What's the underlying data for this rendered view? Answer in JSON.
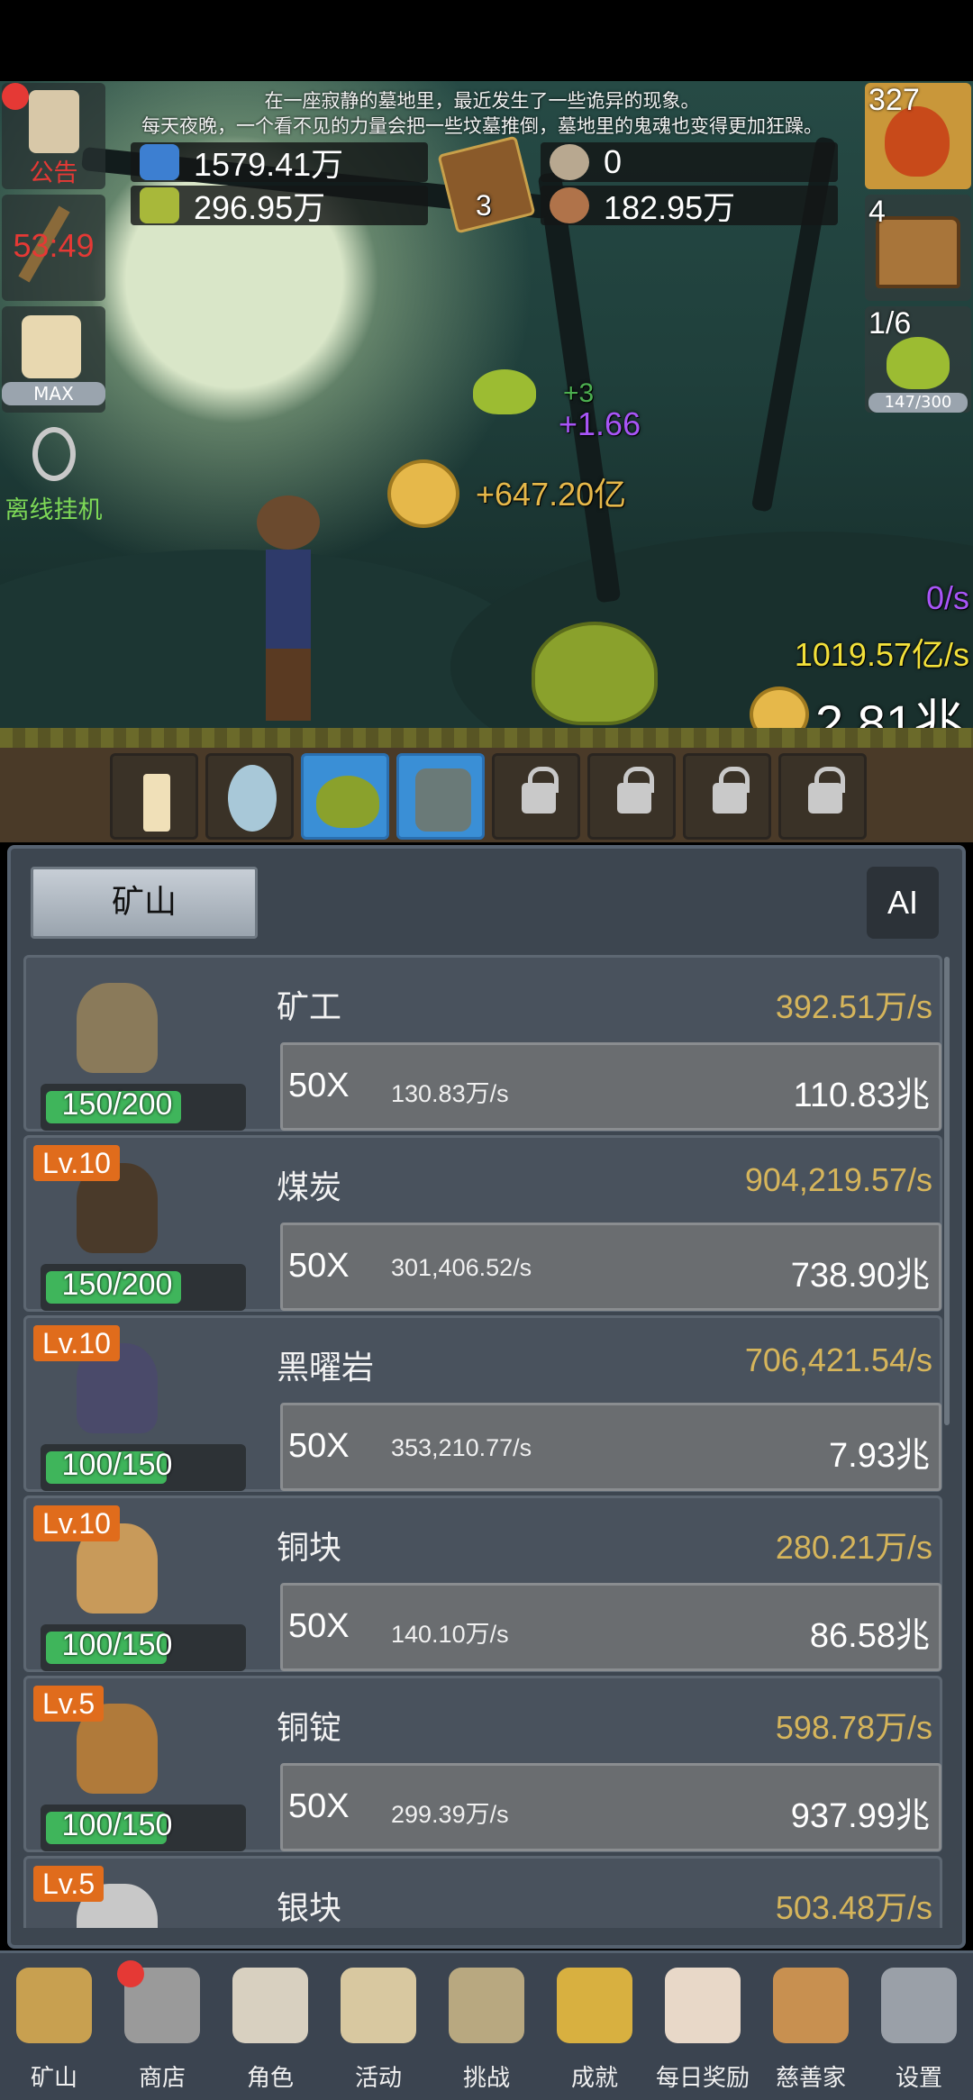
{
  "story": {
    "line1": "在一座寂静的墓地里，最近发生了一些诡异的现象。",
    "line2": "每天夜晚，一个看不见的力量会把一些坟墓推倒，墓地里的鬼魂也变得更加狂躁。"
  },
  "resources": {
    "blue_potion": "1579.41万",
    "green_potion": "296.95万",
    "book_count": "3",
    "shell": "0",
    "meat": "182.95万"
  },
  "left_buttons": {
    "notice": "公告",
    "timer": "53:49",
    "beer": "MAX",
    "offline": "离线挂机"
  },
  "right_buttons": {
    "potion_count": "327",
    "chest_count": "4",
    "slime_count": "1/6",
    "slime_hp": "147/300"
  },
  "floaters": {
    "plus_three": "+3",
    "plus_rate": "+1.66",
    "coin_gain": "+647.20亿",
    "rate_purple": "0/s",
    "rate_yellow": "1019.57亿/s",
    "total_coins": "2.81兆"
  },
  "panel": {
    "tab": "矿山",
    "ai": "AI"
  },
  "rows": [
    {
      "name": "矿工",
      "rate": "392.51万/s",
      "progress": "150/200",
      "fill": 0.75,
      "level": "",
      "mult": "50X",
      "inc": "130.83万/s",
      "cost": "110.83兆"
    },
    {
      "name": "煤炭",
      "rate": "904,219.57/s",
      "progress": "150/200",
      "fill": 0.75,
      "level": "Lv.10",
      "mult": "50X",
      "inc": "301,406.52/s",
      "cost": "738.90兆"
    },
    {
      "name": "黑曜岩",
      "rate": "706,421.54/s",
      "progress": "100/150",
      "fill": 0.67,
      "level": "Lv.10",
      "mult": "50X",
      "inc": "353,210.77/s",
      "cost": "7.93兆"
    },
    {
      "name": "铜块",
      "rate": "280.21万/s",
      "progress": "100/150",
      "fill": 0.67,
      "level": "Lv.10",
      "mult": "50X",
      "inc": "140.10万/s",
      "cost": "86.58兆"
    },
    {
      "name": "铜锭",
      "rate": "598.78万/s",
      "progress": "100/150",
      "fill": 0.67,
      "level": "Lv.5",
      "mult": "50X",
      "inc": "299.39万/s",
      "cost": "937.99兆"
    },
    {
      "name": "银块",
      "rate": "503.48万/s",
      "progress": "",
      "fill": 0,
      "level": "Lv.5",
      "mult": "",
      "inc": "",
      "cost": ""
    }
  ],
  "nav": [
    {
      "label": "矿山",
      "icon": "lantern-icon"
    },
    {
      "label": "商店",
      "icon": "stone-icon"
    },
    {
      "label": "角色",
      "icon": "skull-icon"
    },
    {
      "label": "活动",
      "icon": "scroll-icon"
    },
    {
      "label": "挑战",
      "icon": "map-icon"
    },
    {
      "label": "成就",
      "icon": "key-icon"
    },
    {
      "label": "每日奖励",
      "icon": "envelope-icon"
    },
    {
      "label": "慈善家",
      "icon": "bread-icon"
    },
    {
      "label": "设置",
      "icon": "gear-icon"
    }
  ]
}
